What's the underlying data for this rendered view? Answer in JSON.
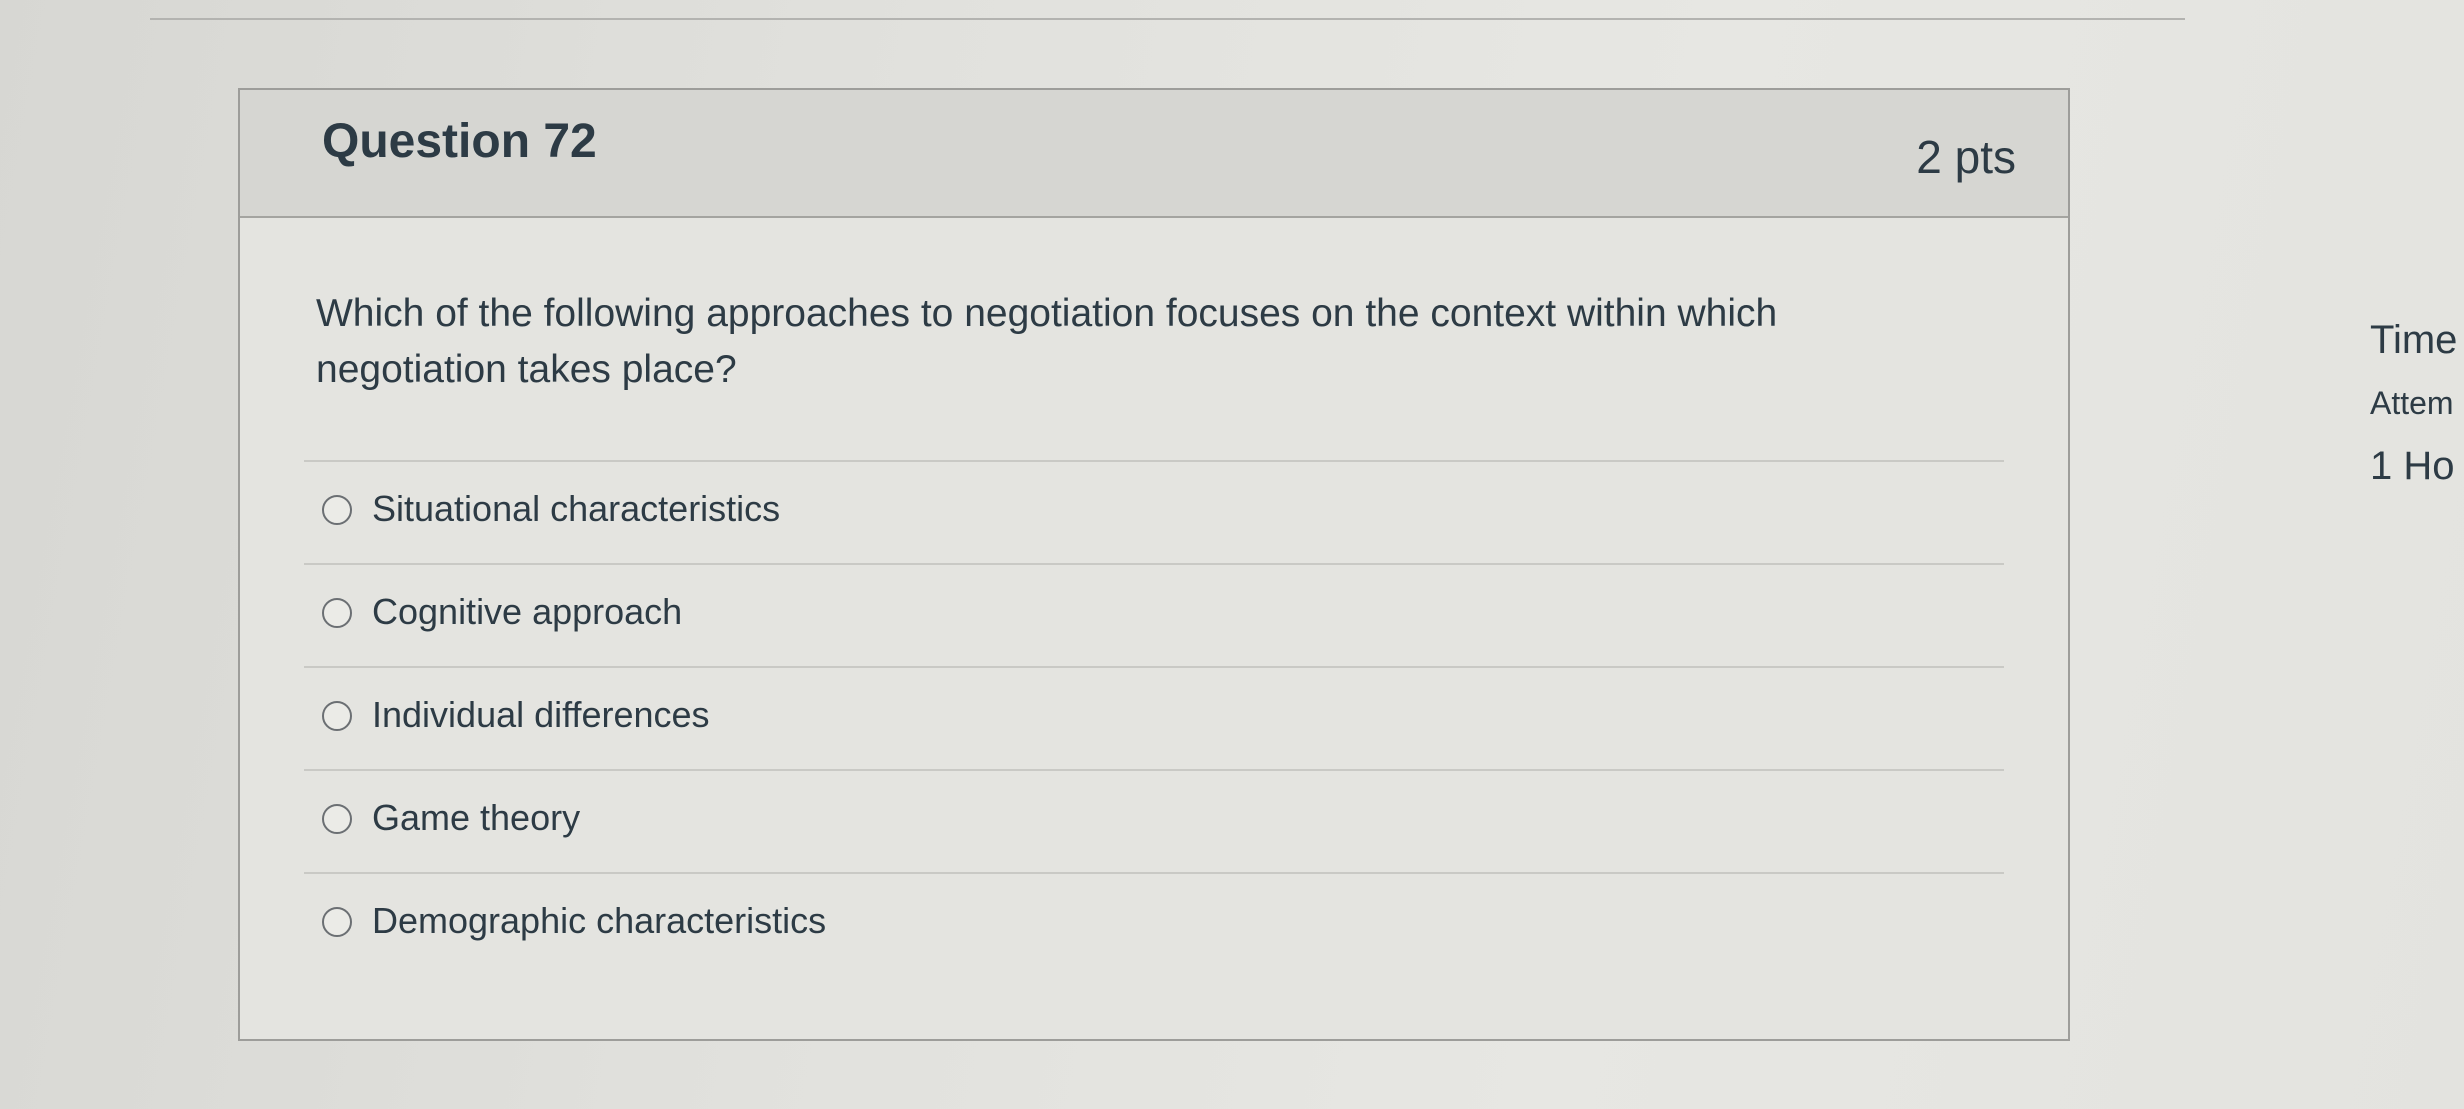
{
  "question": {
    "title": "Question 72",
    "points": "2 pts",
    "text": "Which of the following approaches to negotiation focuses on the context within which negotiation takes place?",
    "answers": [
      {
        "label": "Situational characteristics",
        "selected": false
      },
      {
        "label": "Cognitive approach",
        "selected": false
      },
      {
        "label": "Individual differences",
        "selected": false
      },
      {
        "label": "Game theory",
        "selected": false
      },
      {
        "label": "Demographic characteristics",
        "selected": false
      }
    ]
  },
  "side_panel": {
    "time_label": "Time",
    "attempt_label": "Attem",
    "hours_text": "1 Ho"
  },
  "colors": {
    "text": "#2d3b45",
    "header_bg": "#d6d6d2",
    "card_bg": "#e4e4e0",
    "border": "#9d9d9a"
  }
}
